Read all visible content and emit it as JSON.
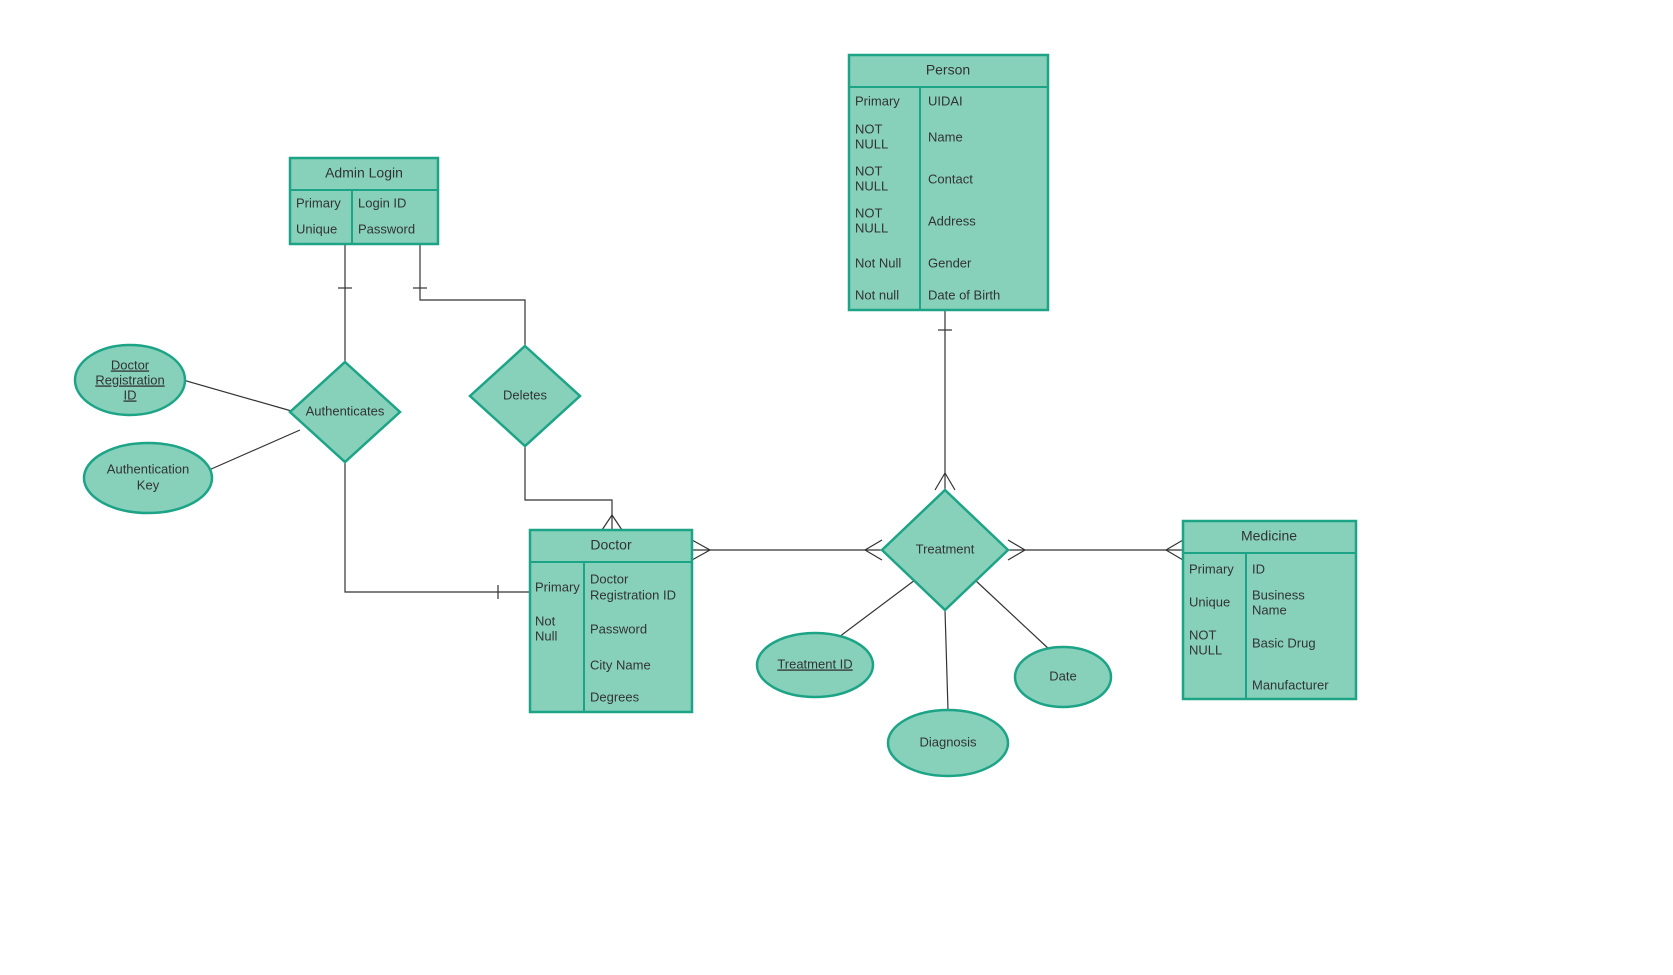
{
  "entities": {
    "adminLogin": {
      "title": "Admin Login",
      "rows": [
        {
          "constraint": "Primary",
          "field": "Login ID"
        },
        {
          "constraint": "Unique",
          "field": "Password"
        }
      ]
    },
    "person": {
      "title": "Person",
      "rows": [
        {
          "constraint": "Primary",
          "field": "UIDAI"
        },
        {
          "constraint": "NOT NULL",
          "field": "Name"
        },
        {
          "constraint": "NOT NULL",
          "field": "Contact"
        },
        {
          "constraint": "NOT NULL",
          "field": "Address"
        },
        {
          "constraint": "Not Null",
          "field": "Gender"
        },
        {
          "constraint": "Not null",
          "field": "Date of Birth"
        }
      ]
    },
    "doctor": {
      "title": "Doctor",
      "rows": [
        {
          "constraint": "Primary",
          "field": "Doctor Registration ID"
        },
        {
          "constraint": "Not Null",
          "field": "Password"
        },
        {
          "constraint": "",
          "field": "City Name"
        },
        {
          "constraint": "",
          "field": "Degrees"
        }
      ]
    },
    "medicine": {
      "title": "Medicine",
      "rows": [
        {
          "constraint": "Primary",
          "field": "ID"
        },
        {
          "constraint": "Unique",
          "field": "Business Name"
        },
        {
          "constraint": "NOT NULL",
          "field": "Basic Drug"
        },
        {
          "constraint": "",
          "field": "Manufacturer"
        }
      ]
    }
  },
  "relationships": {
    "authenticates": "Authenticates",
    "deletes": "Deletes",
    "treatment": "Treatment"
  },
  "attributes": {
    "doctorRegId": "Doctor Registration ID",
    "authKey": "Authentication Key",
    "treatmentId": "Treatment ID",
    "diagnosis": "Diagnosis",
    "date": "Date"
  },
  "colors": {
    "fill": "#87d1bb",
    "stroke": "#1da487",
    "line": "#333333"
  }
}
